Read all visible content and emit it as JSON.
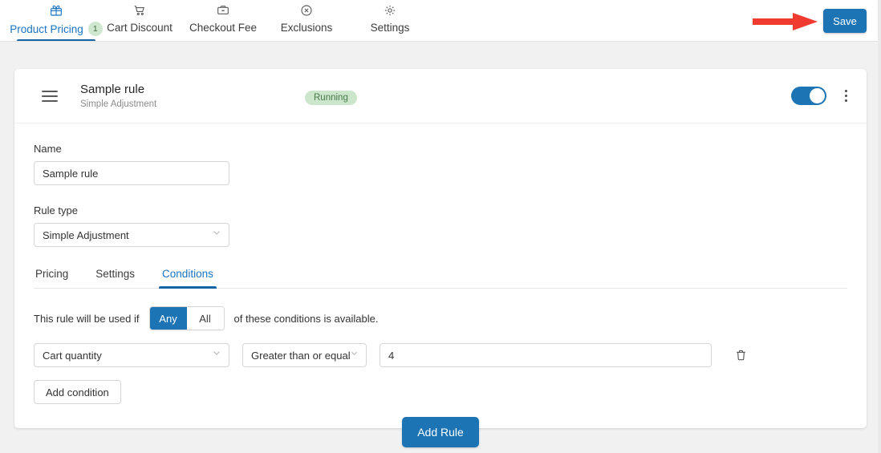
{
  "topbar": {
    "tabs": [
      {
        "label": "Product Pricing",
        "icon": "gift-icon",
        "badge": "1",
        "active": true
      },
      {
        "label": "Cart Discount",
        "icon": "shopping-cart-icon",
        "badge": "",
        "active": false
      },
      {
        "label": "Checkout Fee",
        "icon": "wallet-icon",
        "badge": "",
        "active": false
      },
      {
        "label": "Exclusions",
        "icon": "circle-x-icon",
        "badge": "",
        "active": false
      },
      {
        "label": "Settings",
        "icon": "gear-icon",
        "badge": "",
        "active": false
      }
    ],
    "save_label": "Save"
  },
  "rule_card": {
    "title": "Sample rule",
    "subtitle": "Simple Adjustment",
    "status": "Running",
    "toggle_on": true,
    "name_label": "Name",
    "name_value": "Sample rule",
    "rule_type_label": "Rule type",
    "rule_type_value": "Simple Adjustment",
    "inner_tabs": [
      {
        "label": "Pricing",
        "active": false
      },
      {
        "label": "Settings",
        "active": false
      },
      {
        "label": "Conditions",
        "active": true
      }
    ],
    "conditions": {
      "prefix_text": "This rule will be used if",
      "match_any": "Any",
      "match_all": "All",
      "selected_match": "Any",
      "suffix_text": "of these conditions is available.",
      "rows": [
        {
          "field": "Cart quantity",
          "operator": "Greater than or equal",
          "value": "4"
        }
      ],
      "add_condition_label": "Add condition"
    }
  },
  "footer": {
    "add_rule_label": "Add Rule"
  },
  "colors": {
    "accent_blue": "#1c74b5",
    "tab_active": "#1a73c0",
    "status_bg": "#cce6cc",
    "status_text": "#4a7a4a",
    "annotation_red": "#f03b30",
    "page_bg": "#f1f1f1"
  }
}
